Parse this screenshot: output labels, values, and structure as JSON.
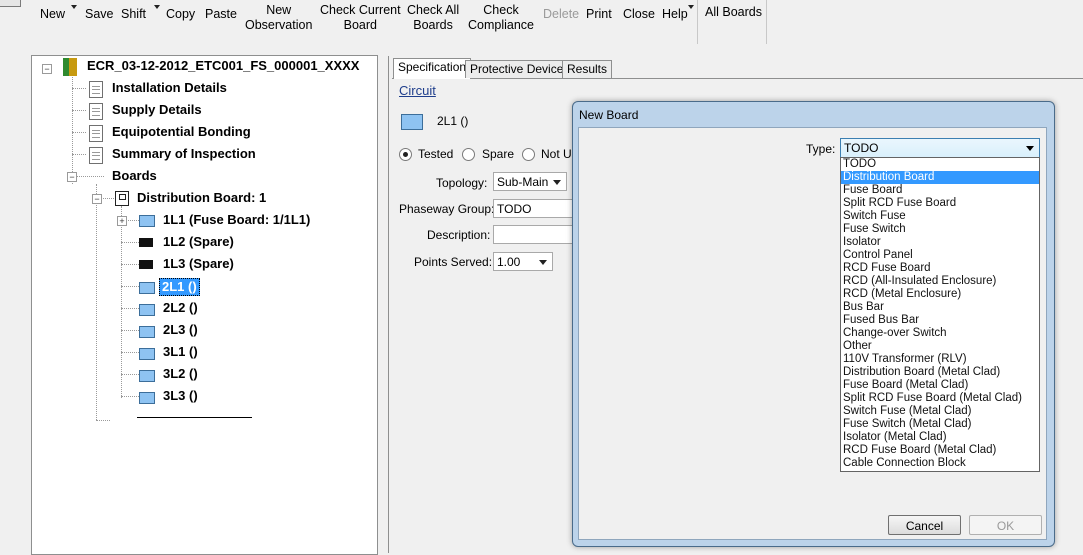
{
  "toolbar": {
    "new": "New",
    "save": "Save",
    "shift": "Shift",
    "copy": "Copy",
    "paste": "Paste",
    "new_observation_1": "New",
    "new_observation_2": "Observation",
    "check_current_1": "Check Current",
    "check_current_2": "Board",
    "check_all_1": "Check All",
    "check_all_2": "Boards",
    "check_compliance_1": "Check",
    "check_compliance_2": "Compliance",
    "delete": "Delete",
    "print": "Print",
    "close": "Close",
    "help": "Help",
    "all_boards": "All Boards"
  },
  "tree": {
    "root": "ECR_03-12-2012_ETC001_FS_000001_XXXX",
    "installation": "Installation Details",
    "supply": "Supply Details",
    "bonding": "Equipotential Bonding",
    "summary": "Summary of Inspection",
    "boards": "Boards",
    "dist_board": "Distribution Board: 1",
    "items": [
      "1L1 (Fuse Board: 1/1L1)",
      "1L2 (Spare)",
      "1L3 (Spare)",
      "2L1 ()",
      "2L2 ()",
      "2L3 ()",
      "3L1 ()",
      "3L2 ()",
      "3L3 ()"
    ]
  },
  "tabs": [
    "Specification",
    "Protective Device",
    "Results"
  ],
  "spec": {
    "circuit_link": "Circuit",
    "circuit_name": "2L1 ()",
    "radio_tested": "Tested",
    "radio_spare": "Spare",
    "radio_not_used": "Not Used",
    "topology_label": "Topology:",
    "topology_value": "Sub-Main",
    "phaseway_label": "Phaseway Group:",
    "phaseway_value": "TODO",
    "description_label": "Description:",
    "points_label": "Points Served:",
    "points_value": "1.00"
  },
  "dialog": {
    "title": "New Board",
    "type_label": "Type:",
    "type_value": "TODO",
    "options": [
      "TODO",
      "Distribution Board",
      "Fuse Board",
      "Split RCD Fuse Board",
      "Switch Fuse",
      "Fuse Switch",
      "Isolator",
      "Control Panel",
      "RCD Fuse Board",
      "RCD (All-Insulated Enclosure)",
      "RCD (Metal Enclosure)",
      "Bus Bar",
      "Fused Bus Bar",
      "Change-over Switch",
      "Other",
      "110V Transformer (RLV)",
      "Distribution Board (Metal Clad)",
      "Fuse Board (Metal Clad)",
      "Split RCD Fuse Board (Metal Clad)",
      "Switch Fuse (Metal Clad)",
      "Fuse Switch (Metal Clad)",
      "Isolator (Metal Clad)",
      "RCD Fuse Board (Metal Clad)",
      "Cable Connection Block"
    ],
    "selected_option": 1,
    "cancel": "Cancel",
    "ok": "OK"
  }
}
